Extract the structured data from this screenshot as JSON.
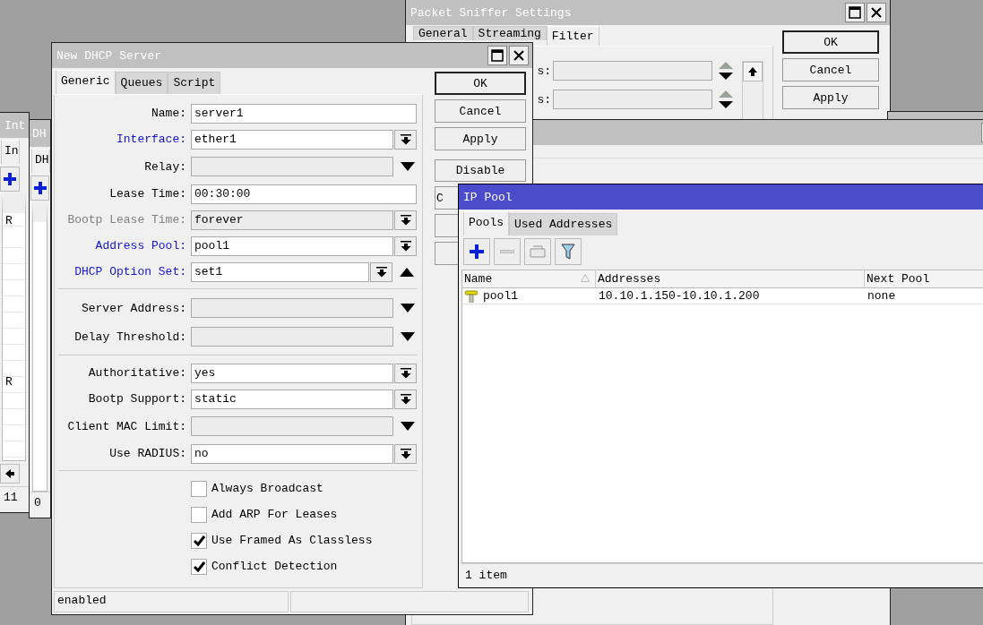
{
  "interfaces_window": {
    "title": "Int",
    "tabs": [
      {
        "label": "In",
        "selected": true
      }
    ],
    "rows": [
      {
        "flag": "R"
      },
      {
        "flag": "R"
      }
    ],
    "status": "11"
  },
  "dhcp_window": {
    "title": "DH",
    "tabs": [
      {
        "label": "DH",
        "selected": true
      }
    ],
    "status": "0"
  },
  "packet_sniffer": {
    "title": "Packet Sniffer Settings",
    "tabs": [
      {
        "label": "General",
        "selected": false
      },
      {
        "label": "Streaming",
        "selected": false
      },
      {
        "label": "Filter",
        "selected": true
      }
    ],
    "fields": [
      {
        "label": "s:"
      },
      {
        "label": "s:"
      }
    ],
    "buttons": [
      "OK",
      "Cancel",
      "Apply"
    ]
  },
  "new_dhcp_server": {
    "title": "New DHCP Server",
    "tabs": [
      {
        "label": "Generic",
        "selected": true
      },
      {
        "label": "Queues",
        "selected": false
      },
      {
        "label": "Script",
        "selected": false
      }
    ],
    "sections": [
      [
        {
          "label": "Name:",
          "value": "server1",
          "kind": "text",
          "link": false,
          "disabled": false
        },
        {
          "label": "Interface:",
          "value": "ether1",
          "kind": "select",
          "link": true,
          "disabled": false,
          "removable": false
        },
        {
          "label": "Relay:",
          "kind": "optional",
          "link": false,
          "disabled": false
        },
        {
          "label": "Lease Time:",
          "value": "00:30:00",
          "kind": "text",
          "link": false,
          "disabled": false
        },
        {
          "label": "Bootp Lease Time:",
          "value": "forever",
          "kind": "select",
          "link": false,
          "disabled": true,
          "removable": false
        },
        {
          "label": "Address Pool:",
          "value": "pool1",
          "kind": "select",
          "link": true,
          "disabled": false,
          "removable": false
        },
        {
          "label": "DHCP Option Set:",
          "value": "set1",
          "kind": "select",
          "link": true,
          "disabled": false,
          "removable": true
        }
      ],
      [
        {
          "label": "Server Address:",
          "kind": "optional",
          "link": false,
          "disabled": false
        },
        {
          "label": "Delay Threshold:",
          "kind": "optional",
          "link": false,
          "disabled": false
        }
      ],
      [
        {
          "label": "Authoritative:",
          "value": "yes",
          "kind": "select",
          "link": false,
          "disabled": false,
          "removable": false
        },
        {
          "label": "Bootp Support:",
          "value": "static",
          "kind": "select",
          "link": false,
          "disabled": false,
          "removable": false
        },
        {
          "label": "Client MAC Limit:",
          "kind": "optional",
          "link": false,
          "disabled": false
        },
        {
          "label": "Use RADIUS:",
          "value": "no",
          "kind": "select",
          "link": false,
          "disabled": false,
          "removable": false
        }
      ]
    ],
    "checkboxes": [
      {
        "label": "Always Broadcast",
        "checked": false
      },
      {
        "label": "Add ARP For Leases",
        "checked": false
      },
      {
        "label": "Use Framed As Classless",
        "checked": true
      },
      {
        "label": "Conflict Detection",
        "checked": true
      }
    ],
    "buttons": [
      "OK",
      "Cancel",
      "Apply",
      "Disable",
      "C"
    ],
    "status": "enabled"
  },
  "ip_pool": {
    "title": "IP Pool",
    "tabs": [
      {
        "label": "Pools",
        "selected": true
      },
      {
        "label": "Used Addresses",
        "selected": false
      }
    ],
    "columns": [
      "Name",
      "Addresses",
      "Next Pool"
    ],
    "rows": [
      {
        "name": "pool1",
        "addresses": "10.10.1.150-10.10.1.200",
        "next_pool": "none"
      }
    ],
    "status": "1 item"
  }
}
